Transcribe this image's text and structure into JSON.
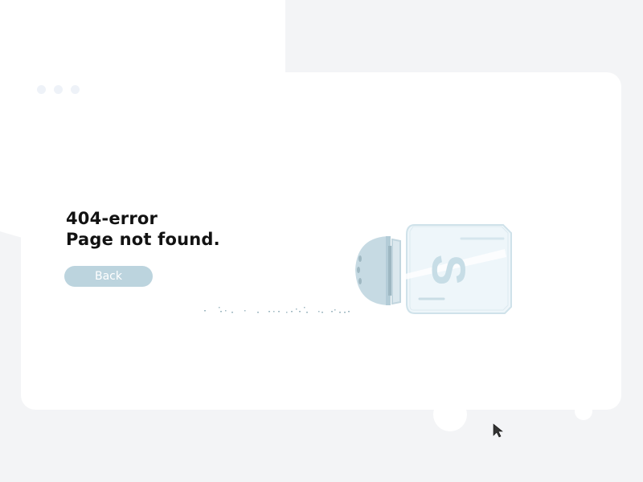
{
  "error": {
    "code_line": "404-error",
    "message_line": "Page not found."
  },
  "actions": {
    "back_label": "Back"
  },
  "illustration": {
    "shaker_letter": "S"
  },
  "colors": {
    "background_shape": "#f3f4f6",
    "card": "#ffffff",
    "window_dots": "#eef2f8",
    "heading_text": "#121212",
    "button": "#bcd4de",
    "button_text": "#ffffff",
    "shaker_glass": "#eef6fa",
    "shaker_outline": "#cfe2ea",
    "shaker_cap": "#c6dae3",
    "shaker_letter": "#c7dde6"
  },
  "icons": [
    "window-dots",
    "salt-shaker-icon",
    "salt-grains",
    "cursor-arrow-icon"
  ]
}
